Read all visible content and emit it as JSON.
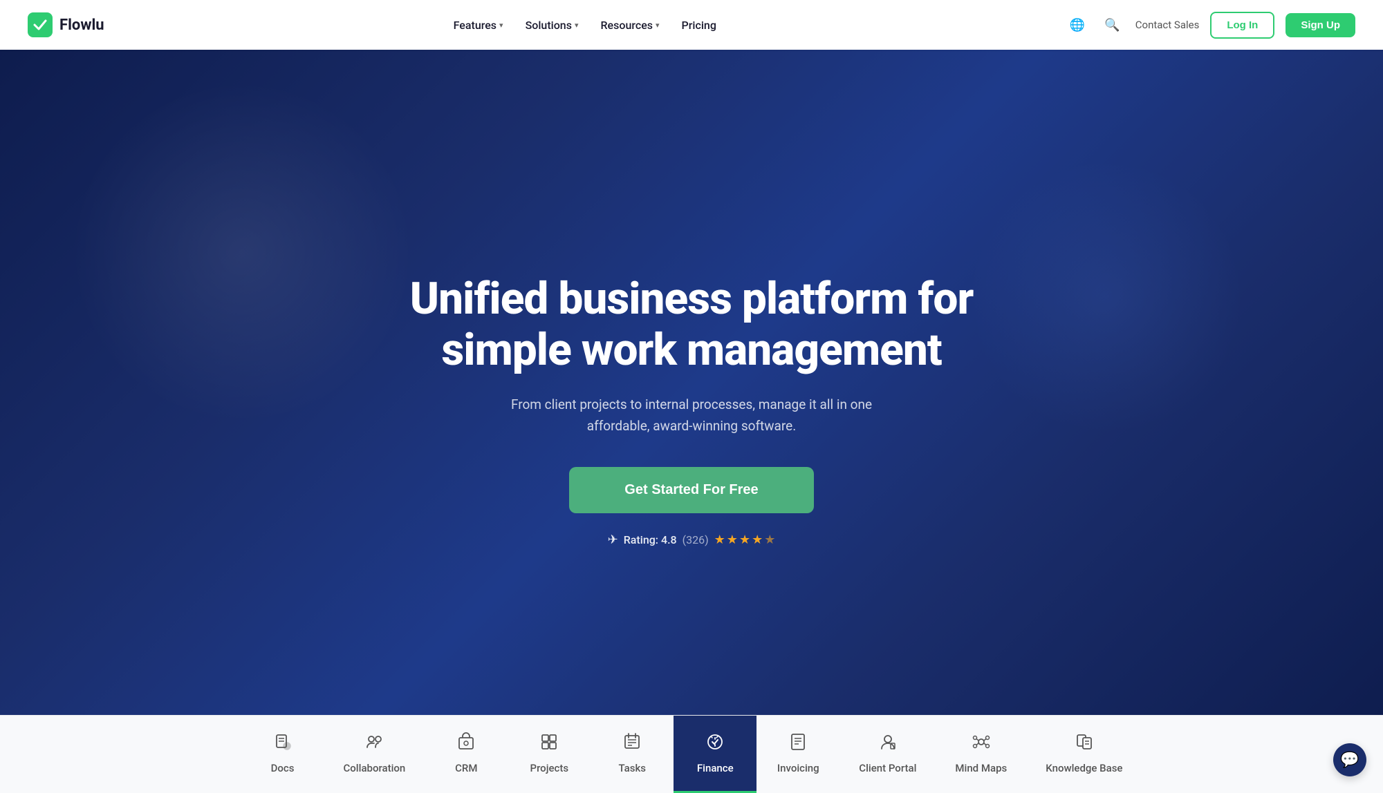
{
  "logo": {
    "text": "Flowlu"
  },
  "nav": {
    "links": [
      {
        "id": "features",
        "label": "Features",
        "hasDropdown": true
      },
      {
        "id": "solutions",
        "label": "Solutions",
        "hasDropdown": true
      },
      {
        "id": "resources",
        "label": "Resources",
        "hasDropdown": true
      },
      {
        "id": "pricing",
        "label": "Pricing",
        "hasDropdown": false
      }
    ],
    "contact_sales": "Contact Sales",
    "login_label": "Log In",
    "signup_label": "Sign Up"
  },
  "hero": {
    "title_line1": "Unified business platform for",
    "title_line2": "simple work management",
    "subtitle": "From client projects to internal processes, manage it all in one affordable, award-winning software.",
    "cta_label": "Get Started For Free",
    "rating": {
      "icon": "✈",
      "text": "Rating: 4.8",
      "count": "(326)"
    }
  },
  "tabs": [
    {
      "id": "docs",
      "icon": "💬",
      "label": "Docs",
      "active": false
    },
    {
      "id": "collaboration",
      "icon": "🔗",
      "label": "Collaboration",
      "active": false
    },
    {
      "id": "crm",
      "icon": "👤",
      "label": "CRM",
      "active": false
    },
    {
      "id": "projects",
      "icon": "⚙",
      "label": "Projects",
      "active": false
    },
    {
      "id": "tasks",
      "icon": "📋",
      "label": "Tasks",
      "active": false
    },
    {
      "id": "finance",
      "icon": "👥",
      "label": "Finance",
      "active": true
    },
    {
      "id": "invoicing",
      "icon": "📄",
      "label": "Invoicing",
      "active": false
    },
    {
      "id": "client-portal",
      "icon": "🧑",
      "label": "Client Portal",
      "active": false
    },
    {
      "id": "mind-maps",
      "icon": "🧠",
      "label": "Mind Maps",
      "active": false
    },
    {
      "id": "knowledge-base",
      "icon": "📚",
      "label": "Knowledge Base",
      "active": false
    }
  ],
  "chat": {
    "icon": "💬"
  },
  "colors": {
    "green": "#2ecc71",
    "dark_blue": "#1a2d6b",
    "hero_bg_start": "#0d1b4b",
    "hero_bg_end": "#1e3a8a"
  }
}
